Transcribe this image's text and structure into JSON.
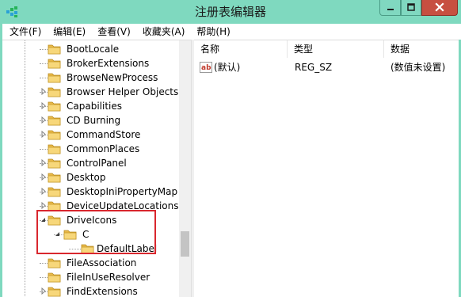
{
  "window": {
    "title": "注册表编辑器",
    "accent_color": "#7fd9bf",
    "close_color": "#c74f41",
    "app_icon": "regedit-icon"
  },
  "menu": [
    "文件(F)",
    "编辑(E)",
    "查看(V)",
    "收藏夹(A)",
    "帮助(H)"
  ],
  "tree": {
    "items": [
      {
        "label": "BootLocale",
        "expandable": false,
        "expanded": false,
        "level": 0
      },
      {
        "label": "BrokerExtensions",
        "expandable": false,
        "expanded": false,
        "level": 0
      },
      {
        "label": "BrowseNewProcess",
        "expandable": false,
        "expanded": false,
        "level": 0
      },
      {
        "label": "Browser Helper Objects",
        "expandable": true,
        "expanded": false,
        "level": 0
      },
      {
        "label": "Capabilities",
        "expandable": true,
        "expanded": false,
        "level": 0
      },
      {
        "label": "CD Burning",
        "expandable": true,
        "expanded": false,
        "level": 0
      },
      {
        "label": "CommandStore",
        "expandable": true,
        "expanded": false,
        "level": 0
      },
      {
        "label": "CommonPlaces",
        "expandable": false,
        "expanded": false,
        "level": 0
      },
      {
        "label": "ControlPanel",
        "expandable": true,
        "expanded": false,
        "level": 0
      },
      {
        "label": "Desktop",
        "expandable": true,
        "expanded": false,
        "level": 0
      },
      {
        "label": "DesktopIniPropertyMap",
        "expandable": true,
        "expanded": false,
        "level": 0
      },
      {
        "label": "DeviceUpdateLocations",
        "expandable": true,
        "expanded": false,
        "level": 0
      },
      {
        "label": "DriveIcons",
        "expandable": true,
        "expanded": true,
        "level": 0
      },
      {
        "label": "C",
        "expandable": true,
        "expanded": true,
        "level": 1
      },
      {
        "label": "DefaultLabel",
        "expandable": false,
        "expanded": false,
        "level": 2,
        "selected": true
      },
      {
        "label": "FileAssociation",
        "expandable": false,
        "expanded": false,
        "level": 0
      },
      {
        "label": "FileInUseResolver",
        "expandable": false,
        "expanded": false,
        "level": 0
      },
      {
        "label": "FindExtensions",
        "expandable": true,
        "expanded": false,
        "level": 0
      }
    ]
  },
  "list": {
    "columns": [
      "名称",
      "类型",
      "数据"
    ],
    "rows": [
      {
        "icon": "string-value-icon",
        "name": "(默认)",
        "type": "REG_SZ",
        "data": "(数值未设置)"
      }
    ]
  },
  "highlight_color": "#d9272e"
}
